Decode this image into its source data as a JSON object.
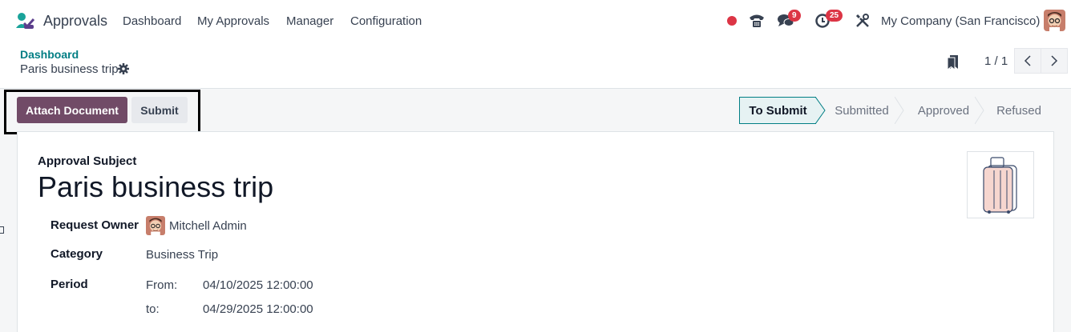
{
  "navbar": {
    "app_name": "Approvals",
    "menu": [
      "Dashboard",
      "My Approvals",
      "Manager",
      "Configuration"
    ],
    "messages_count": "9",
    "activities_count": "25",
    "company": "My Company (San Francisco)"
  },
  "control_panel": {
    "breadcrumb": "Dashboard",
    "record_title": "Paris business trip",
    "pager": "1 / 1"
  },
  "statusbar": {
    "attach_label": "Attach Document",
    "submit_label": "Submit",
    "stages": [
      "To Submit",
      "Submitted",
      "Approved",
      "Refused"
    ],
    "active_stage": "To Submit"
  },
  "form": {
    "subject_label": "Approval Subject",
    "subject": "Paris business trip",
    "owner_label": "Request Owner",
    "owner": "Mitchell Admin",
    "category_label": "Category",
    "category": "Business Trip",
    "period_label": "Period",
    "from_label": "From:",
    "from_value": "04/10/2025 12:00:00",
    "to_label": "to:",
    "to_value": "04/29/2025 12:00:00"
  },
  "colors": {
    "brand": "#714b67",
    "link": "#017e84",
    "badge": "#dc3545"
  }
}
